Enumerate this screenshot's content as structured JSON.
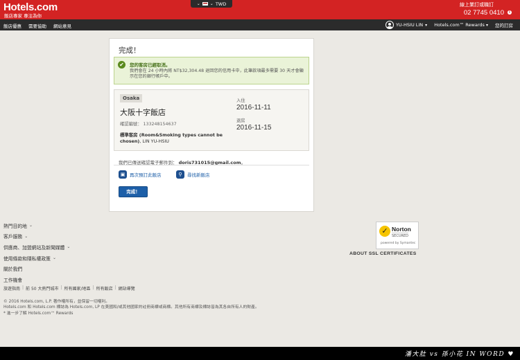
{
  "header": {
    "logo": "Hotels.com",
    "logo_tagline": "飯店專家 專注為你",
    "currency": "TWD",
    "booking_link": "線上業訂或職訂",
    "phone": "02 7745 0410",
    "info_icon": "info-icon"
  },
  "nav": {
    "left": [
      "飯店優惠",
      "需要協助",
      "網站意見"
    ],
    "user": "YU-HSIU LIN",
    "rewards": "Hotels.com™ Rewards",
    "my_bookings": "您的訂房"
  },
  "confirmation": {
    "title": "完成！",
    "success_title": "您的客房已經取消。",
    "success_body": "我們會在 24 小時內將 NT$32,304.48 退回您的信用卡中，此筆款項最多需要 30 天才會顯示在您的銀行帳戶中。",
    "city": "Osaka",
    "hotel_name": "大阪十字飯店",
    "conf_label": "確認編號：",
    "conf_number": "133248154637",
    "room_type": "標準客房 (Room&Smoking types cannot be chosen)",
    "guest": ", LIN YU-HSIU",
    "checkin_label": "入住",
    "checkin_date": "2016-11-11",
    "checkout_label": "退房",
    "checkout_date": "2016-11-15",
    "email_prefix": "我們已傳送確認電子郵件到：",
    "email": "doris731015@gmail.com",
    "email_suffix": "。",
    "rebook_label": "再次預訂此飯店",
    "find_new_label": "尋找新飯店",
    "done_button": "完成！"
  },
  "footer": {
    "links": [
      {
        "label": "熱門目的地",
        "chevron": true
      },
      {
        "label": "客戶服務",
        "chevron": true
      },
      {
        "label": "供應商、加盟網站及新聞媒體",
        "chevron": true
      },
      {
        "label": "使用條款和隱私權政策",
        "chevron": true
      },
      {
        "label": "關於我們",
        "chevron": false
      },
      {
        "label": "工作機會",
        "chevron": false
      }
    ],
    "mini_links": [
      "旅遊指南",
      "前 50 大熱門城市",
      "所有國家/地區",
      "所有飯店",
      "網站導覽"
    ],
    "legal": [
      "© 2016 Hotels.com, L.P. 著作權所有，並保留一切權利。",
      "Hotels.com 和 Hotels.com 標誌為 Hotels.com, LP 在美國和/或其他國家的註冊商標或商標。其他所有商標及標誌皆為其各自所有人的財產。",
      "* 進一步了解 Hotels.com™ Rewards"
    ],
    "norton_name": "Norton",
    "norton_secured": "SECURED",
    "norton_by": "powered by Symantec",
    "ssl_label": "ABOUT SSL CERTIFICATES"
  },
  "watermark": "潘大肚 vs 孫小花 IN WORD ♥"
}
